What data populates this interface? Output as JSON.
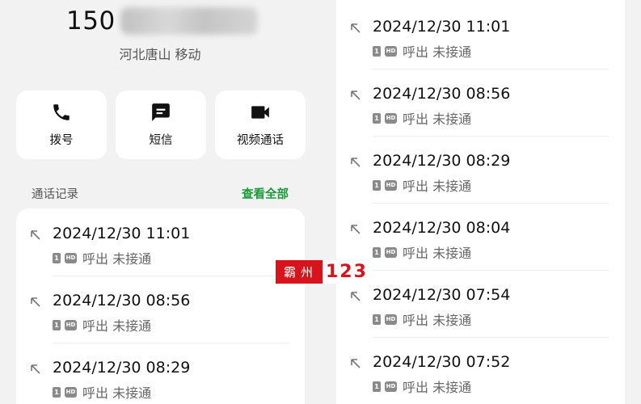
{
  "contact": {
    "number_prefix": "150",
    "location": "河北唐山 移动"
  },
  "actions": [
    {
      "label": "拨号",
      "icon": "phone-icon"
    },
    {
      "label": "短信",
      "icon": "message-icon"
    },
    {
      "label": "视频通话",
      "icon": "video-camera-icon"
    }
  ],
  "calllog": {
    "title": "通话记录",
    "view_all": "查看全部",
    "badges": {
      "sim": "1",
      "hd": "HD"
    },
    "left_entries": [
      {
        "time": "2024/12/30 11:01",
        "status": "呼出 未接通"
      },
      {
        "time": "2024/12/30 08:56",
        "status": "呼出 未接通"
      },
      {
        "time": "2024/12/30 08:29",
        "status": "呼出 未接通"
      }
    ],
    "right_entries": [
      {
        "time": "2024/12/30 11:01",
        "status": "呼出 未接通"
      },
      {
        "time": "2024/12/30 08:56",
        "status": "呼出 未接通"
      },
      {
        "time": "2024/12/30 08:29",
        "status": "呼出 未接通"
      },
      {
        "time": "2024/12/30 08:04",
        "status": "呼出 未接通"
      },
      {
        "time": "2024/12/30 07:54",
        "status": "呼出 未接通"
      },
      {
        "time": "2024/12/30 07:52",
        "status": "呼出 未接通"
      }
    ]
  },
  "watermark": {
    "chars": "霸州",
    "number": "123"
  },
  "colors": {
    "accent_green": "#1a9a3a",
    "watermark_red": "#d7131b",
    "background": "#f2f2f2"
  }
}
